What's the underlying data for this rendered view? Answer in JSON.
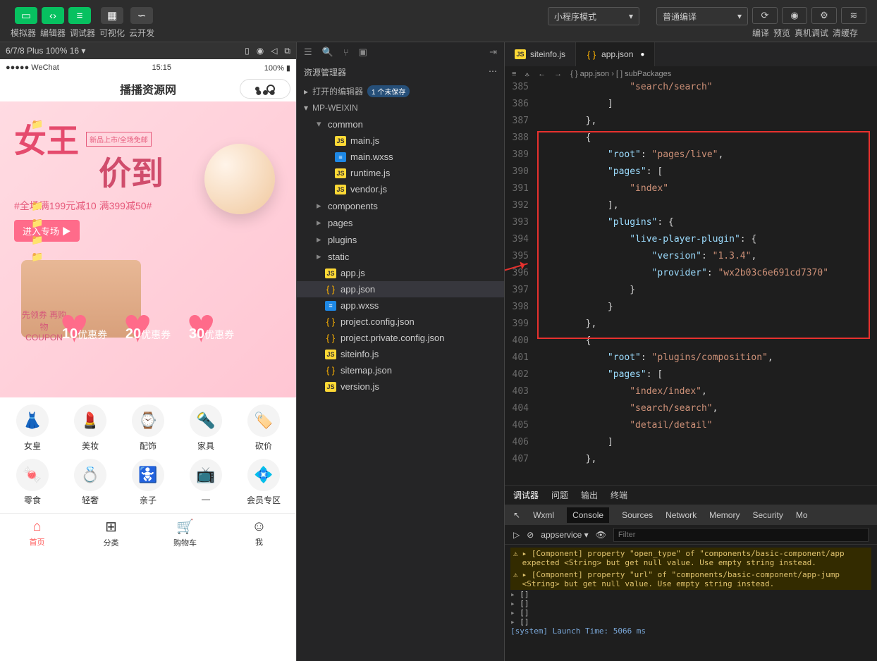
{
  "topbar": {
    "labels": [
      "模拟器",
      "编辑器",
      "调试器",
      "可视化",
      "云开发"
    ],
    "mode_dd": "小程序模式",
    "compile_dd": "普通编译",
    "right_labels": [
      "编译",
      "预览",
      "真机调试",
      "清缓存"
    ]
  },
  "sim_head": "6/7/8 Plus 100% 16 ▾",
  "sim": {
    "wechat": "●●●●● WeChat",
    "time": "15:15",
    "battery": "100%",
    "title": "播播资源网",
    "banner": {
      "big1": "女王",
      "big2": "价到",
      "mini": "新品上市/全场免邮",
      "sub": "#全场满199元减10 满399减50#",
      "enter": "进入专场 ▶",
      "coupon_label_top": "先领券 再购物",
      "coupon_label_bot": "COUPON",
      "coupons": [
        {
          "num": "10",
          "txt": "优惠券"
        },
        {
          "num": "20",
          "txt": "优惠券"
        },
        {
          "num": "30",
          "txt": "优惠券"
        }
      ]
    },
    "cats": [
      {
        "icon": "👗",
        "name": "女皇"
      },
      {
        "icon": "💄",
        "name": "美妆"
      },
      {
        "icon": "⌚",
        "name": "配饰"
      },
      {
        "icon": "🔦",
        "name": "家具"
      },
      {
        "icon": "🏷️",
        "name": "砍价"
      },
      {
        "icon": "🍬",
        "name": "零食"
      },
      {
        "icon": "💍",
        "name": "轻奢"
      },
      {
        "icon": "🚼",
        "name": "亲子"
      },
      {
        "icon": "📺",
        "name": "—"
      },
      {
        "icon": "💠",
        "name": "会员专区"
      }
    ],
    "tabs": [
      {
        "glyph": "⌂",
        "name": "首页",
        "active": true
      },
      {
        "glyph": "⊞",
        "name": "分类"
      },
      {
        "glyph": "🛒",
        "name": "购物车"
      },
      {
        "glyph": "☺",
        "name": "我"
      }
    ]
  },
  "tree": {
    "title": "资源管理器",
    "open_editors": "打开的编辑器",
    "unsaved": "1 个未保存",
    "root": "MP-WEIXIN",
    "folders": [
      "common",
      "components",
      "pages",
      "plugins",
      "static"
    ],
    "common_files": [
      "main.js",
      "main.wxss",
      "runtime.js",
      "vendor.js"
    ],
    "root_files": [
      {
        "n": "app.js",
        "t": "js"
      },
      {
        "n": "app.json",
        "t": "json",
        "sel": true
      },
      {
        "n": "app.wxss",
        "t": "wxss"
      },
      {
        "n": "project.config.json",
        "t": "json"
      },
      {
        "n": "project.private.config.json",
        "t": "json"
      },
      {
        "n": "siteinfo.js",
        "t": "js"
      },
      {
        "n": "sitemap.json",
        "t": "json"
      },
      {
        "n": "version.js",
        "t": "js"
      }
    ]
  },
  "editor": {
    "tab1": "siteinfo.js",
    "tab2": "app.json",
    "crumbs": "{ } app.json  ›  [ ] subPackages",
    "lines": [
      {
        "n": 385,
        "t": "                \"search/search\""
      },
      {
        "n": 386,
        "t": "            ]"
      },
      {
        "n": 387,
        "t": "        },"
      },
      {
        "n": 388,
        "t": "        {"
      },
      {
        "n": 389,
        "t": "            \"root\": \"pages/live\","
      },
      {
        "n": 390,
        "t": "            \"pages\": ["
      },
      {
        "n": 391,
        "t": "                \"index\""
      },
      {
        "n": 392,
        "t": "            ],"
      },
      {
        "n": 393,
        "t": "            \"plugins\": {"
      },
      {
        "n": 394,
        "t": "                \"live-player-plugin\": {"
      },
      {
        "n": 395,
        "t": "                    \"version\": \"1.3.4\","
      },
      {
        "n": 396,
        "t": "                    \"provider\": \"wx2b03c6e691cd7370\""
      },
      {
        "n": 397,
        "t": "                }"
      },
      {
        "n": 398,
        "t": "            }"
      },
      {
        "n": 399,
        "t": "        },"
      },
      {
        "n": 400,
        "t": "        {"
      },
      {
        "n": 401,
        "t": "            \"root\": \"plugins/composition\","
      },
      {
        "n": 402,
        "t": "            \"pages\": ["
      },
      {
        "n": 403,
        "t": "                \"index/index\","
      },
      {
        "n": 404,
        "t": "                \"search/search\","
      },
      {
        "n": 405,
        "t": "                \"detail/detail\""
      },
      {
        "n": 406,
        "t": "            ]"
      },
      {
        "n": 407,
        "t": "        },"
      }
    ]
  },
  "dev": {
    "tabs": [
      "调试器",
      "问题",
      "输出",
      "终端"
    ],
    "tabs2": [
      "Wxml",
      "Console",
      "Sources",
      "Network",
      "Memory",
      "Security",
      "Mo"
    ],
    "context": "appservice",
    "filter_ph": "Filter",
    "warn1": "▸ [Component] property \"open_type\" of \"components/basic-component/app expected <String> but get null value. Use empty string instead.",
    "warn2": "▸ [Component] property \"url\" of \"components/basic-component/app-jump <String> but get null value. Use empty string instead.",
    "obj": "[]",
    "last": "[system] Launch Time: 5066 ms"
  }
}
